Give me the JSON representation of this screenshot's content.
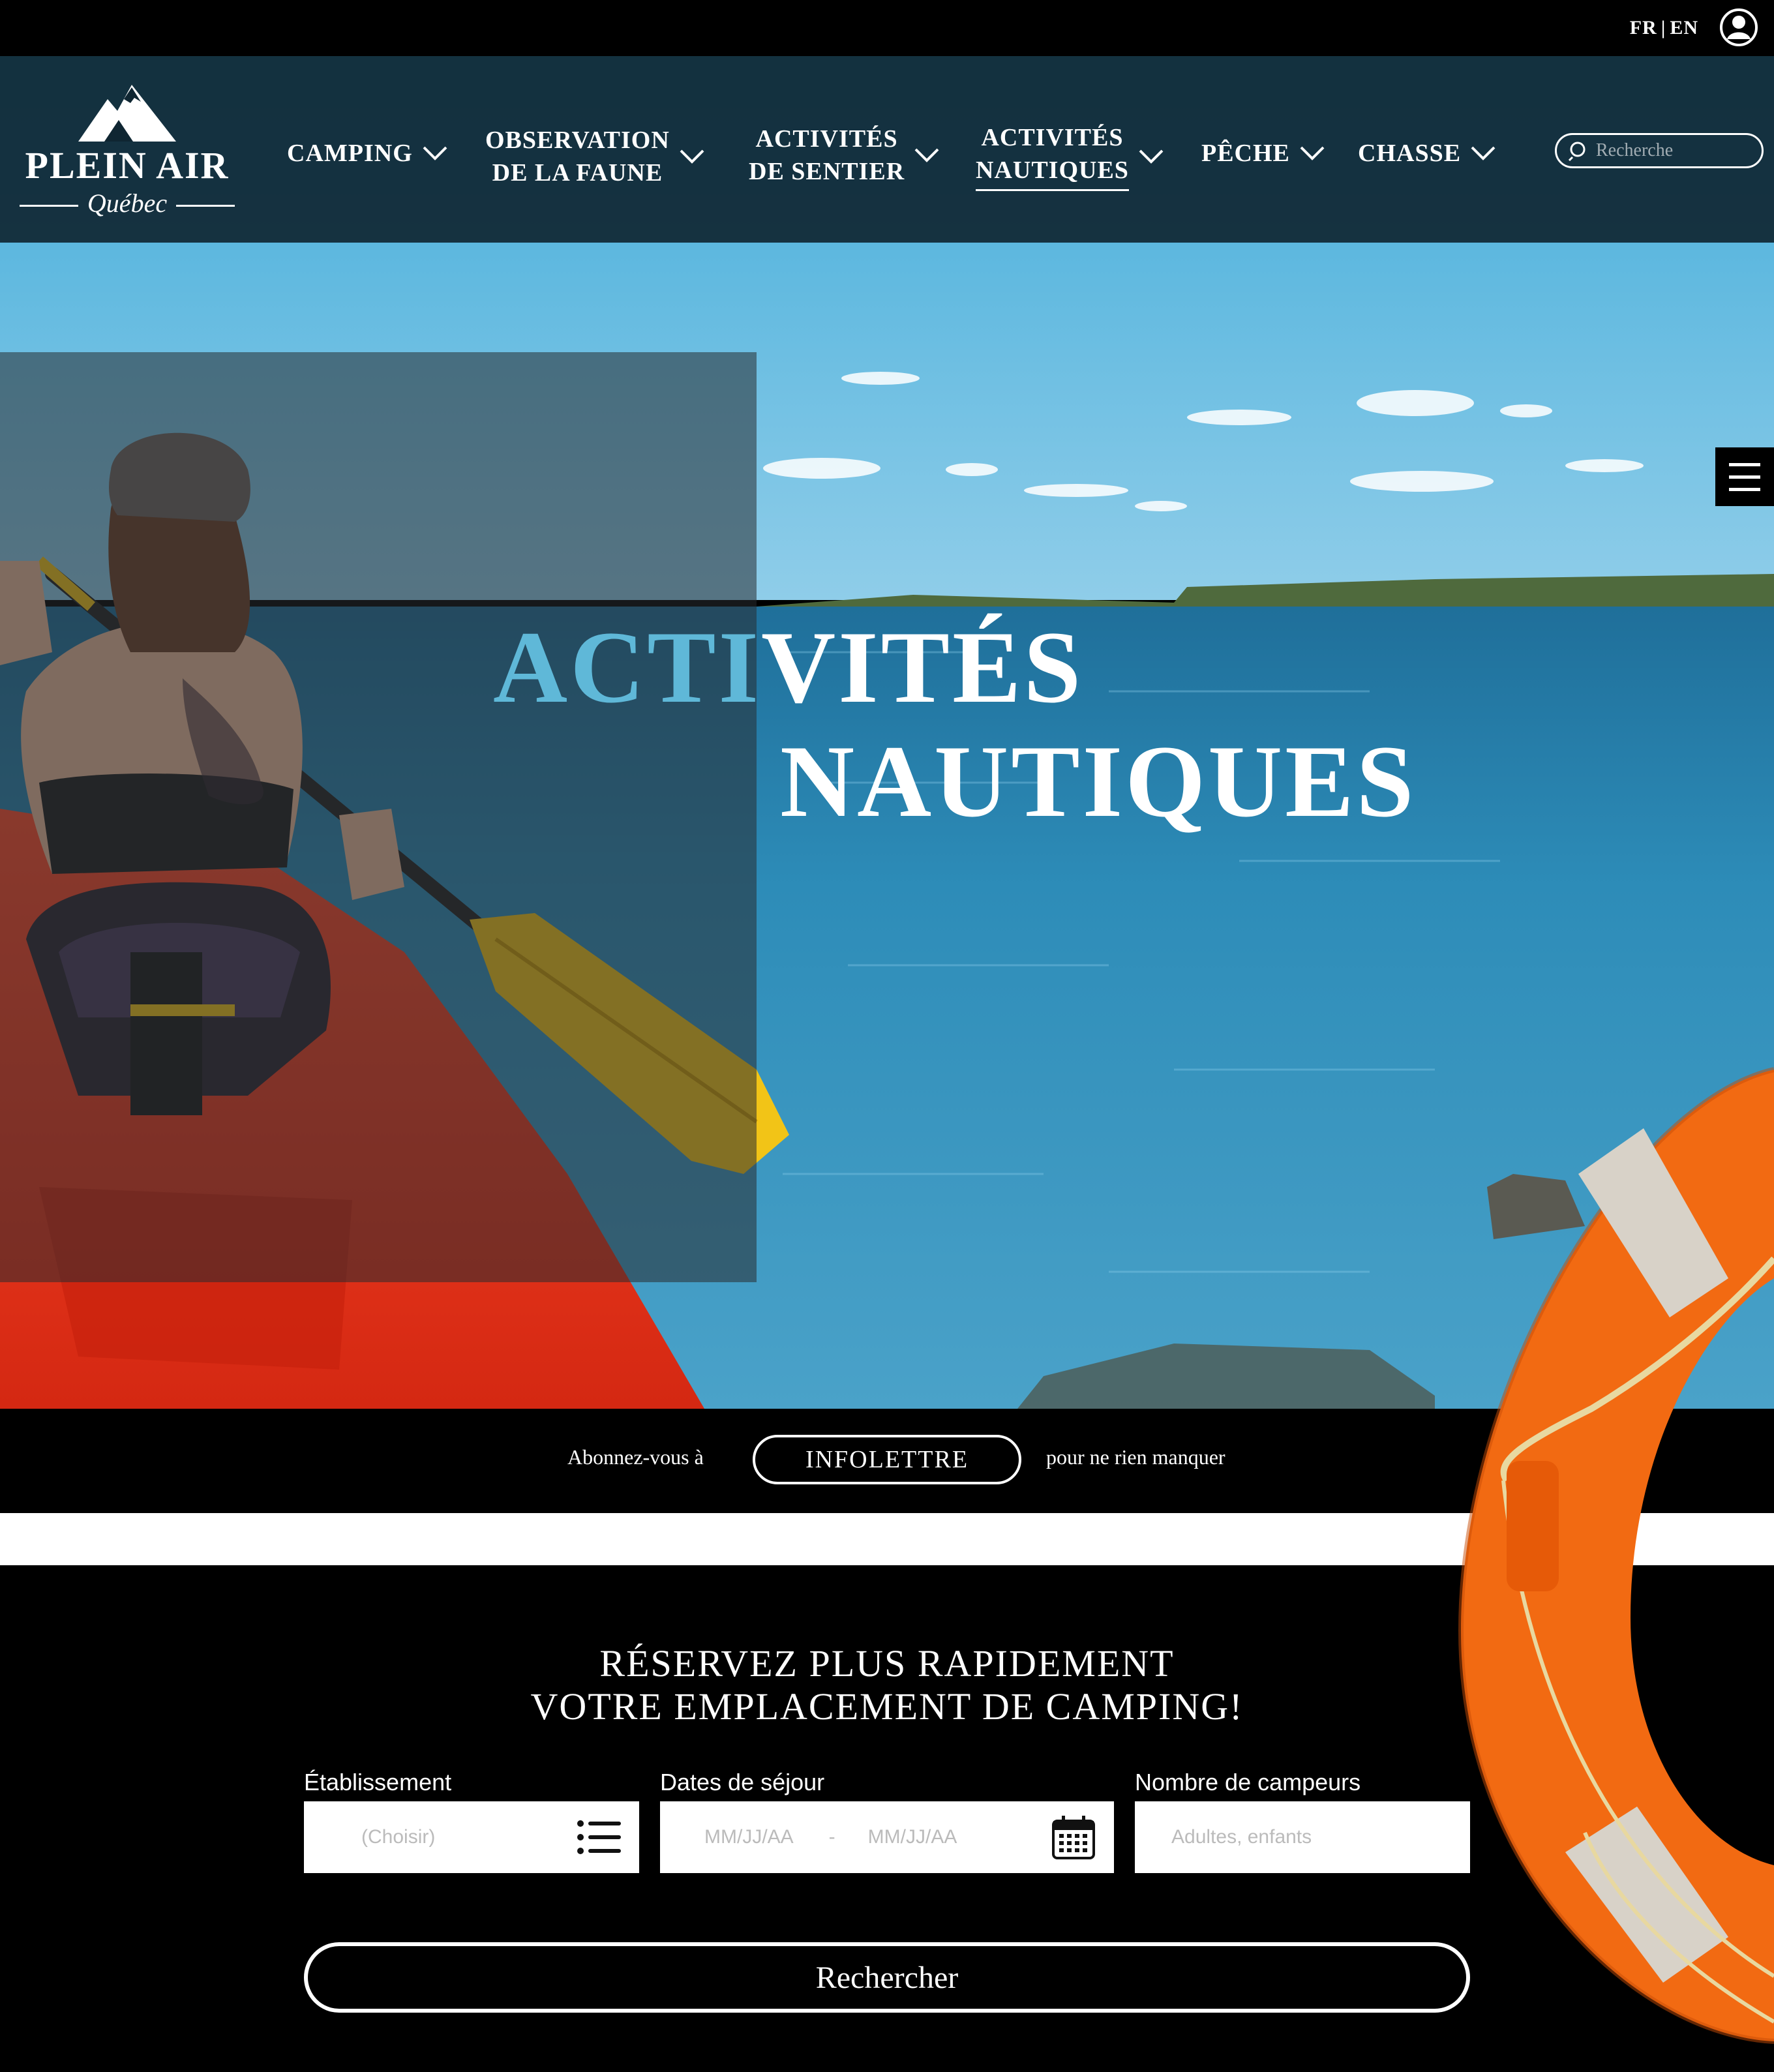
{
  "top_bar": {
    "lang_fr": "FR",
    "lang_sep": "|",
    "lang_en": "EN"
  },
  "logo": {
    "title": "PLEIN AIR",
    "subtitle": "Québec"
  },
  "nav": {
    "items": [
      {
        "label": "CAMPING"
      },
      {
        "label": "OBSERVATION\nDE LA FAUNE"
      },
      {
        "label": "ACTIVITÉS\nDE SENTIER"
      },
      {
        "label": "ACTIVITÉS\nNAUTIQUES",
        "active": true
      },
      {
        "label": "PÊCHE"
      },
      {
        "label": "CHASSE"
      }
    ],
    "search_placeholder": "Recherche"
  },
  "hero": {
    "title_line1_a": "ACTI",
    "title_line1_b": "VITÉS",
    "title_line2": "NAUTIQUES"
  },
  "newsletter": {
    "pre_text": "Abonnez-vous à",
    "button_label": "INFOLETTRE",
    "post_text": "pour ne rien manquer"
  },
  "booking": {
    "title": "RÉSERVEZ PLUS RAPIDEMENT\nVOTRE EMPLACEMENT DE CAMPING!",
    "establishment": {
      "label": "Établissement",
      "placeholder": "(Choisir)"
    },
    "dates": {
      "label": "Dates de séjour",
      "start_placeholder": "MM/JJ/AA",
      "separator": "-",
      "end_placeholder": "MM/JJ/AA"
    },
    "campers": {
      "label": "Nombre de campeurs",
      "placeholder": "Adultes, enfants"
    },
    "search_button": "Rechercher"
  },
  "colors": {
    "header_bg": "#0f2632",
    "accent_blue": "#5fb8d8",
    "kayak_red": "#e8301c",
    "paddle_yellow": "#f2c417",
    "lifebuoy_orange": "#f26a12"
  }
}
